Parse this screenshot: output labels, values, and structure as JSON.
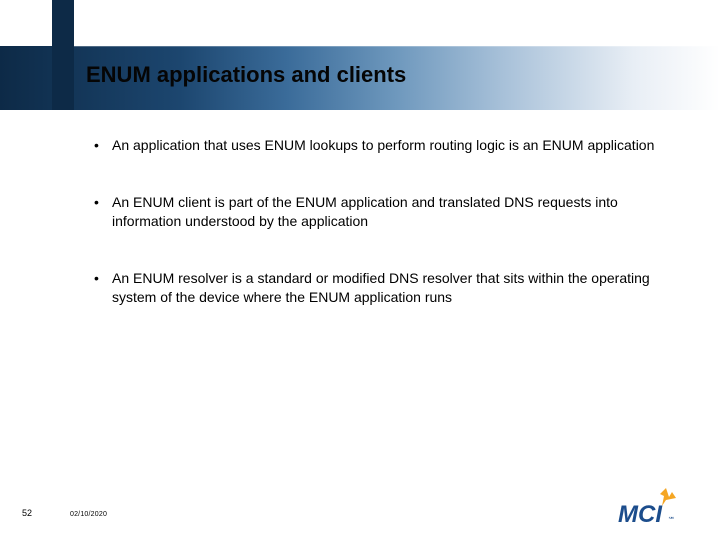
{
  "slide": {
    "title": "ENUM applications and clients",
    "bullets": [
      "An application that uses ENUM lookups to perform routing logic is an ENUM application",
      "An ENUM client is part of the ENUM application and translated DNS requests into information understood by the application",
      "An ENUM resolver is a standard or modified DNS resolver that sits within the operating system of the device where the ENUM application runs"
    ]
  },
  "footer": {
    "page_number": "52",
    "date": "02/10/2020"
  },
  "logo": {
    "name": "MCI",
    "brand_color": "#1c4d8c",
    "accent_color": "#f5a623"
  }
}
